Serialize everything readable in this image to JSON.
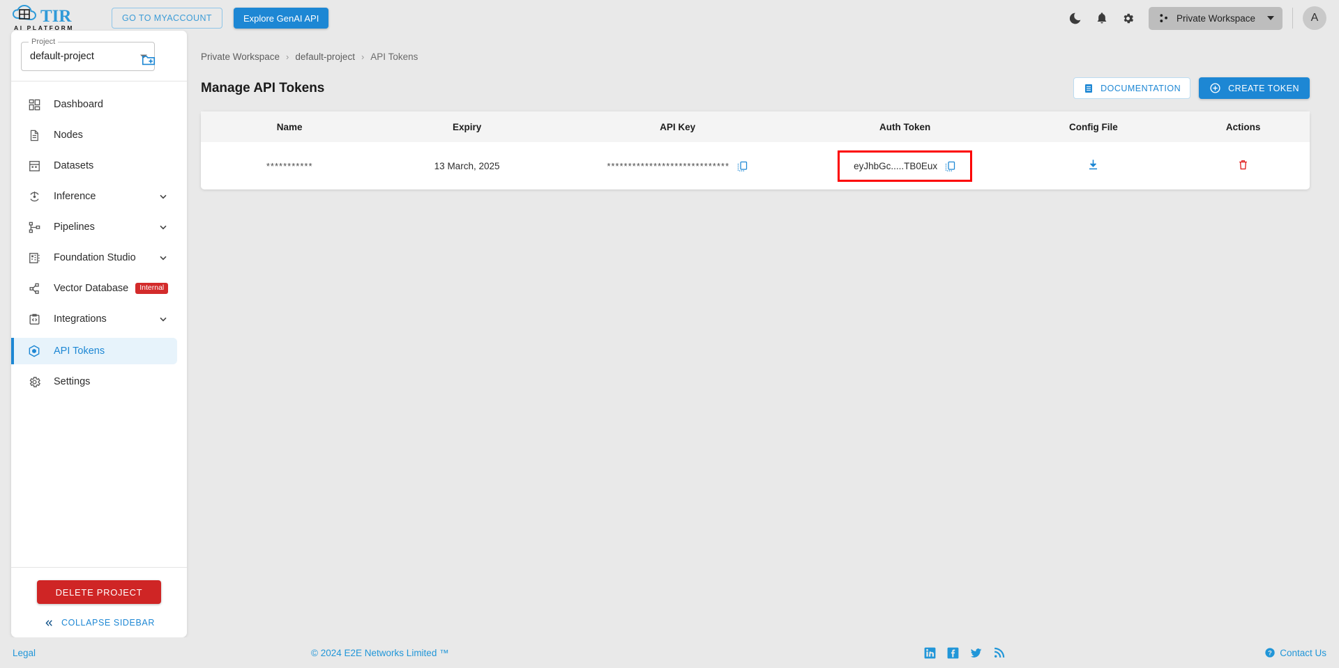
{
  "topbar": {
    "logo_primary": "TIR",
    "logo_secondary": "AI PLATFORM",
    "myaccount_label": "GO TO MYACCOUNT",
    "genai_label": "Explore GenAI API",
    "icons": [
      "dark-mode-icon",
      "notifications-icon",
      "settings-gear-icon"
    ],
    "workspace_label": "Private Workspace",
    "avatar_initial": "A"
  },
  "sidebar": {
    "project_legend": "Project",
    "project_value": "default-project",
    "new_project_icon": "new-folder-icon",
    "items": [
      {
        "label": "Dashboard",
        "icon": "dashboard-icon",
        "chevron": false,
        "active": false,
        "badge": null
      },
      {
        "label": "Nodes",
        "icon": "nodes-document-icon",
        "chevron": false,
        "active": false,
        "badge": null
      },
      {
        "label": "Datasets",
        "icon": "datasets-grid-icon",
        "chevron": false,
        "active": false,
        "badge": null
      },
      {
        "label": "Inference",
        "icon": "inference-icon",
        "chevron": true,
        "active": false,
        "badge": null
      },
      {
        "label": "Pipelines",
        "icon": "pipelines-icon",
        "chevron": true,
        "active": false,
        "badge": null
      },
      {
        "label": "Foundation Studio",
        "icon": "foundation-studio-icon",
        "chevron": true,
        "active": false,
        "badge": null
      },
      {
        "label": "Vector Database",
        "icon": "vector-database-icon",
        "chevron": false,
        "active": false,
        "badge": "Internal"
      },
      {
        "label": "Integrations",
        "icon": "integrations-code-icon",
        "chevron": true,
        "active": false,
        "badge": null
      },
      {
        "label": "API Tokens",
        "icon": "api-tokens-icon",
        "chevron": false,
        "active": true,
        "badge": null
      },
      {
        "label": "Settings",
        "icon": "settings-gear-icon",
        "chevron": false,
        "active": false,
        "badge": null
      }
    ],
    "delete_project_label": "DELETE PROJECT",
    "collapse_label": "COLLAPSE SIDEBAR"
  },
  "main": {
    "breadcrumb": [
      "Private Workspace",
      "default-project",
      "API Tokens"
    ],
    "breadcrumb_separator": "›",
    "page_title": "Manage API Tokens",
    "documentation_label": "DOCUMENTATION",
    "create_token_label": "CREATE TOKEN"
  },
  "table": {
    "columns": [
      "Name",
      "Expiry",
      "API Key",
      "Auth Token",
      "Config File",
      "Actions"
    ],
    "rows": [
      {
        "name": "***********",
        "expiry": "13 March, 2025",
        "api_key": "*****************************",
        "api_key_copy_icon": "copy-icon",
        "auth_token": "eyJhbGc.....TB0Eux",
        "auth_token_copy_icon": "copy-icon",
        "auth_token_highlighted": true,
        "config_file_icon": "download-icon",
        "actions_icon": "delete-trash-icon"
      }
    ]
  },
  "footer": {
    "legal": "Legal",
    "copyright": "© 2024 E2E Networks Limited ™",
    "social": [
      "linkedin-icon",
      "facebook-icon",
      "twitter-icon",
      "rss-icon"
    ],
    "contact": "Contact Us"
  },
  "colors": {
    "accent_blue": "#1d87d4",
    "danger_red": "#cf2525",
    "highlight_red": "#fc0000",
    "page_bg": "#e9e9e9",
    "active_nav_bg": "#e7f3fb"
  }
}
